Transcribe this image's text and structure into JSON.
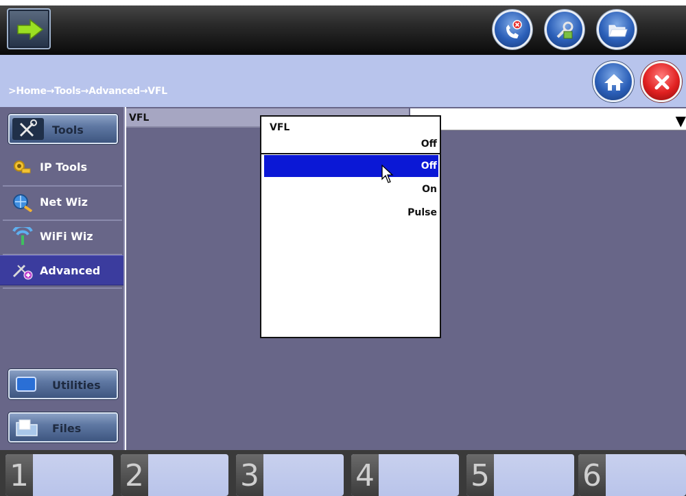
{
  "header": {
    "back_icon": "forward-arrow-icon",
    "round_buttons": [
      "phone-disconnect-icon",
      "tools-settings-icon",
      "folder-open-icon"
    ]
  },
  "breadcrumb": ">Home→Tools→Advanced→VFL",
  "nav_buttons": {
    "home_icon": "home-icon",
    "close_icon": "close-icon"
  },
  "sidebar": {
    "tools": "Tools",
    "items": [
      {
        "label": "IP Tools",
        "icon": "ip-tools-icon"
      },
      {
        "label": "Net Wiz",
        "icon": "net-wiz-icon"
      },
      {
        "label": "WiFi Wiz",
        "icon": "wifi-wiz-icon"
      },
      {
        "label": "Advanced",
        "icon": "advanced-icon",
        "active": true
      }
    ],
    "utilities": "Utilities",
    "files": "Files"
  },
  "main": {
    "field_label": "VFL",
    "select_value": "",
    "arrow": "▼"
  },
  "popup": {
    "title": "VFL",
    "current": "Off",
    "options": [
      "Off",
      "On",
      "Pulse"
    ],
    "selected_index": 0
  },
  "fkeys": [
    "1",
    "2",
    "3",
    "4",
    "5",
    "6"
  ],
  "colors": {
    "crumb_band": "#b8c4ec",
    "panel": "#686688",
    "selection": "#0b18d6",
    "active_nav": "#3b3c9e"
  }
}
